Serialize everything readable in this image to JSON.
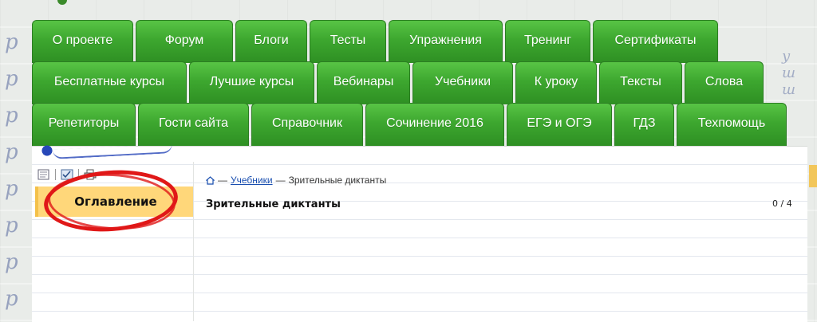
{
  "nav": {
    "row1": [
      {
        "label": "О проекте",
        "name": "tab-about"
      },
      {
        "label": "Форум",
        "name": "tab-forum"
      },
      {
        "label": "Блоги",
        "name": "tab-blogs"
      },
      {
        "label": "Тесты",
        "name": "tab-tests"
      },
      {
        "label": "Упражнения",
        "name": "tab-exercises"
      },
      {
        "label": "Тренинг",
        "name": "tab-training"
      },
      {
        "label": "Сертификаты",
        "name": "tab-certificates"
      }
    ],
    "row2": [
      {
        "label": "Бесплатные курсы",
        "name": "tab-free-courses"
      },
      {
        "label": "Лучшие курсы",
        "name": "tab-best-courses"
      },
      {
        "label": "Вебинары",
        "name": "tab-webinars"
      },
      {
        "label": "Учебники",
        "name": "tab-textbooks"
      },
      {
        "label": "К уроку",
        "name": "tab-to-lesson"
      },
      {
        "label": "Тексты",
        "name": "tab-texts"
      },
      {
        "label": "Слова",
        "name": "tab-words"
      }
    ],
    "row3": [
      {
        "label": "Репетиторы",
        "name": "tab-tutors"
      },
      {
        "label": "Гости сайта",
        "name": "tab-guests"
      },
      {
        "label": "Справочник",
        "name": "tab-reference"
      },
      {
        "label": "Сочинение 2016",
        "name": "tab-essay-2016"
      },
      {
        "label": "ЕГЭ и ОГЭ",
        "name": "tab-ege-oge"
      },
      {
        "label": "ГДЗ",
        "name": "tab-gdz"
      },
      {
        "label": "Техпомощь",
        "name": "tab-tech-support"
      }
    ]
  },
  "sidebar": {
    "toc_label": "Оглавление"
  },
  "breadcrumb": {
    "separator": "—",
    "link": "Учебники",
    "current": "Зрительные диктанты"
  },
  "main": {
    "title": "Зрительные диктанты",
    "counter": "0 / 4"
  },
  "icons": [
    "document-icon",
    "checklist-icon",
    "print-icon",
    "home-icon"
  ],
  "colors": {
    "tab_green": "#3da72f",
    "toc_yellow": "#ffd77a",
    "annotation_red": "#e01818",
    "link_blue": "#1a4fb0"
  }
}
